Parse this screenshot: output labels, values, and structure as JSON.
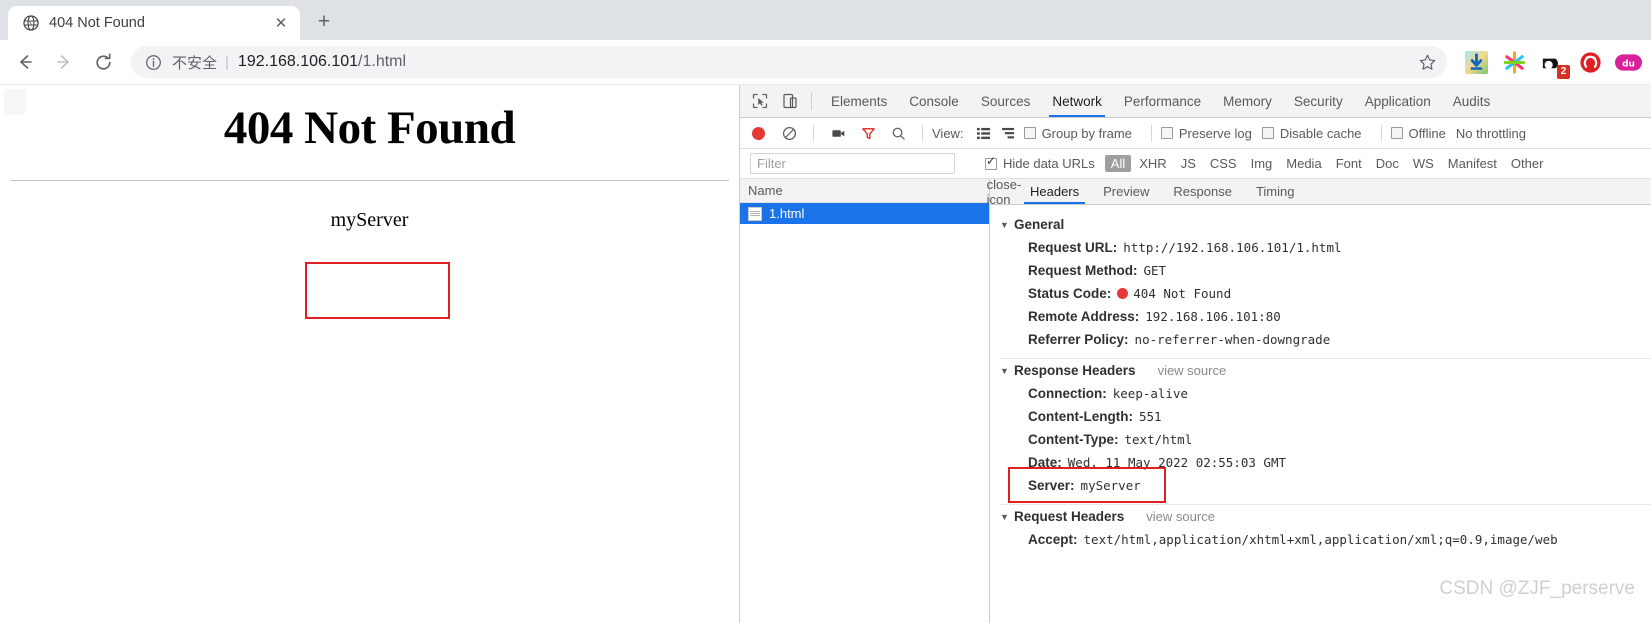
{
  "browser": {
    "tab": {
      "title": "404 Not Found",
      "favicon": "globe-icon",
      "close": "✕"
    },
    "newtab_label": "+",
    "nav": {
      "back": "←",
      "forward": "→",
      "reload": "↻"
    },
    "omnibox": {
      "security_icon": "info-circle-icon",
      "security_text": "不安全",
      "separator": "|",
      "url_host": "192.168.106.101",
      "url_path": "/1.html",
      "bookmark_icon": "star-icon"
    },
    "extensions": [
      {
        "name": "download-extension-icon",
        "badge": ""
      },
      {
        "name": "asterisk-extension-icon",
        "badge": ""
      },
      {
        "name": "dark-extension-icon",
        "badge": "2"
      },
      {
        "name": "adblock-extension-icon",
        "badge": ""
      },
      {
        "name": "baidu-extension-icon",
        "label": "du",
        "badge": ""
      }
    ]
  },
  "page": {
    "heading": "404 Not Found",
    "server_text": "myServer",
    "annotation_color": "#e02020"
  },
  "devtools": {
    "main_tabs": [
      {
        "label": "Elements",
        "active": false
      },
      {
        "label": "Console",
        "active": false
      },
      {
        "label": "Sources",
        "active": false
      },
      {
        "label": "Network",
        "active": true
      },
      {
        "label": "Performance",
        "active": false
      },
      {
        "label": "Memory",
        "active": false
      },
      {
        "label": "Security",
        "active": false
      },
      {
        "label": "Application",
        "active": false
      },
      {
        "label": "Audits",
        "active": false
      }
    ],
    "inspect_icon": "inspect-element-icon",
    "device_icon": "toggle-device-toolbar-icon",
    "network_toolbar": {
      "record_icon": "record-button-icon",
      "clear_icon": "clear-button-icon",
      "capture_screenshots_icon": "camera-icon",
      "filter_icon": "filter-funnel-icon",
      "search_icon": "search-icon",
      "view_label": "View:",
      "view_list_icon": "list-view-icon",
      "view_waterfall_icon": "waterfall-view-icon",
      "group_by_frame": {
        "label": "Group by frame",
        "checked": false
      },
      "preserve_log": {
        "label": "Preserve log",
        "checked": false
      },
      "disable_cache": {
        "label": "Disable cache",
        "checked": false
      },
      "offline": {
        "label": "Offline",
        "checked": false
      },
      "throttling": "No throttling"
    },
    "filter_bar": {
      "filter_placeholder": "Filter",
      "filter_value": "",
      "hide_data_urls": {
        "label": "Hide data URLs",
        "checked": true
      },
      "types": [
        {
          "label": "All",
          "active": true
        },
        {
          "label": "XHR",
          "active": false
        },
        {
          "label": "JS",
          "active": false
        },
        {
          "label": "CSS",
          "active": false
        },
        {
          "label": "Img",
          "active": false
        },
        {
          "label": "Media",
          "active": false
        },
        {
          "label": "Font",
          "active": false
        },
        {
          "label": "Doc",
          "active": false
        },
        {
          "label": "WS",
          "active": false
        },
        {
          "label": "Manifest",
          "active": false
        },
        {
          "label": "Other",
          "active": false
        }
      ]
    },
    "request_list": {
      "column_header": "Name",
      "rows": [
        {
          "name": "1.html",
          "icon": "document-icon",
          "selected": true
        }
      ]
    },
    "detail_tabs": [
      {
        "label": "Headers",
        "active": true
      },
      {
        "label": "Preview",
        "active": false
      },
      {
        "label": "Response",
        "active": false
      },
      {
        "label": "Timing",
        "active": false
      }
    ],
    "detail_close_icon": "close-icon",
    "headers": {
      "general": {
        "title": "General",
        "rows": [
          {
            "key": "Request URL:",
            "value": "http://192.168.106.101/1.html"
          },
          {
            "key": "Request Method:",
            "value": "GET"
          },
          {
            "key": "Status Code:",
            "value": "404 Not Found",
            "status_dot": true
          },
          {
            "key": "Remote Address:",
            "value": "192.168.106.101:80"
          },
          {
            "key": "Referrer Policy:",
            "value": "no-referrer-when-downgrade"
          }
        ]
      },
      "response": {
        "title": "Response Headers",
        "view_source": "view source",
        "rows": [
          {
            "key": "Connection:",
            "value": "keep-alive"
          },
          {
            "key": "Content-Length:",
            "value": "551"
          },
          {
            "key": "Content-Type:",
            "value": "text/html"
          },
          {
            "key": "Date:",
            "value": "Wed, 11 May 2022 02:55:03 GMT"
          },
          {
            "key": "Server:",
            "value": "myServer",
            "highlighted": true
          }
        ]
      },
      "request": {
        "title": "Request Headers",
        "view_source": "view source",
        "rows": [
          {
            "key": "Accept:",
            "value": "text/html,application/xhtml+xml,application/xml;q=0.9,image/web"
          }
        ]
      }
    },
    "watermark": "CSDN @ZJF_perserve"
  }
}
